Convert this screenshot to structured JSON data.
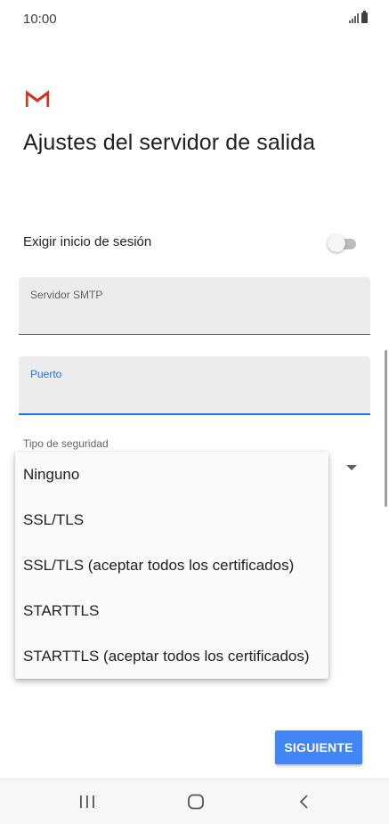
{
  "status_bar": {
    "time": "10:00"
  },
  "header": {
    "title": "Ajustes del servidor de salida",
    "logo_icon": "gmail-icon"
  },
  "signin": {
    "label": "Exigir inicio de sesión",
    "enabled": false
  },
  "smtp_field": {
    "label": "Servidor SMTP",
    "value": ""
  },
  "port_field": {
    "label": "Puerto",
    "value": ""
  },
  "security": {
    "label": "Tipo de seguridad",
    "options": [
      "Ninguno",
      "SSL/TLS",
      "SSL/TLS (aceptar todos los certificados)",
      "STARTTLS",
      "STARTTLS (aceptar todos los certificados)"
    ]
  },
  "actions": {
    "next_label": "SIGUIENTE"
  },
  "colors": {
    "accent": "#4285f4",
    "focus": "#1a73e8",
    "gmail_red": "#d93025"
  },
  "navbar": {
    "recents_icon": "recents-icon",
    "home_icon": "home-icon",
    "back_icon": "back-icon"
  }
}
